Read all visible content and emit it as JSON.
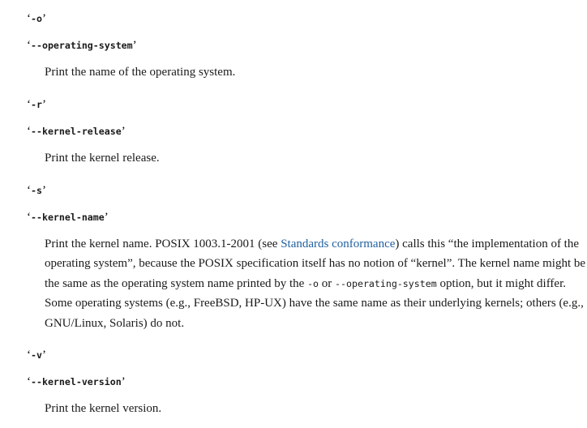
{
  "quote_open": "‘",
  "quote_close": "’",
  "entries": [
    {
      "short": "-o",
      "long": "--operating-system",
      "description": "Print the name of the operating system."
    },
    {
      "short": "-r",
      "long": "--kernel-release",
      "description": "Print the kernel release."
    },
    {
      "short": "-s",
      "long": "--kernel-name",
      "description_parts": {
        "p1": "Print the kernel name. POSIX 1003.1-2001 (see ",
        "link": "Standards conformance",
        "p2": ") calls this “the implementation of the operating system”, because the POSIX specification itself has no notion of “kernel”. The kernel name might be the same as the operating system name printed by the ",
        "code1": "-o",
        "p3": " or ",
        "code2": "--operating-system",
        "p4": " option, but it might differ. Some operating systems (e.g., FreeBSD, HP-UX) have the same name as their underlying kernels; others (e.g., GNU/Linux, Solaris) do not."
      }
    },
    {
      "short": "-v",
      "long": "--kernel-version",
      "description": "Print the kernel version."
    }
  ]
}
